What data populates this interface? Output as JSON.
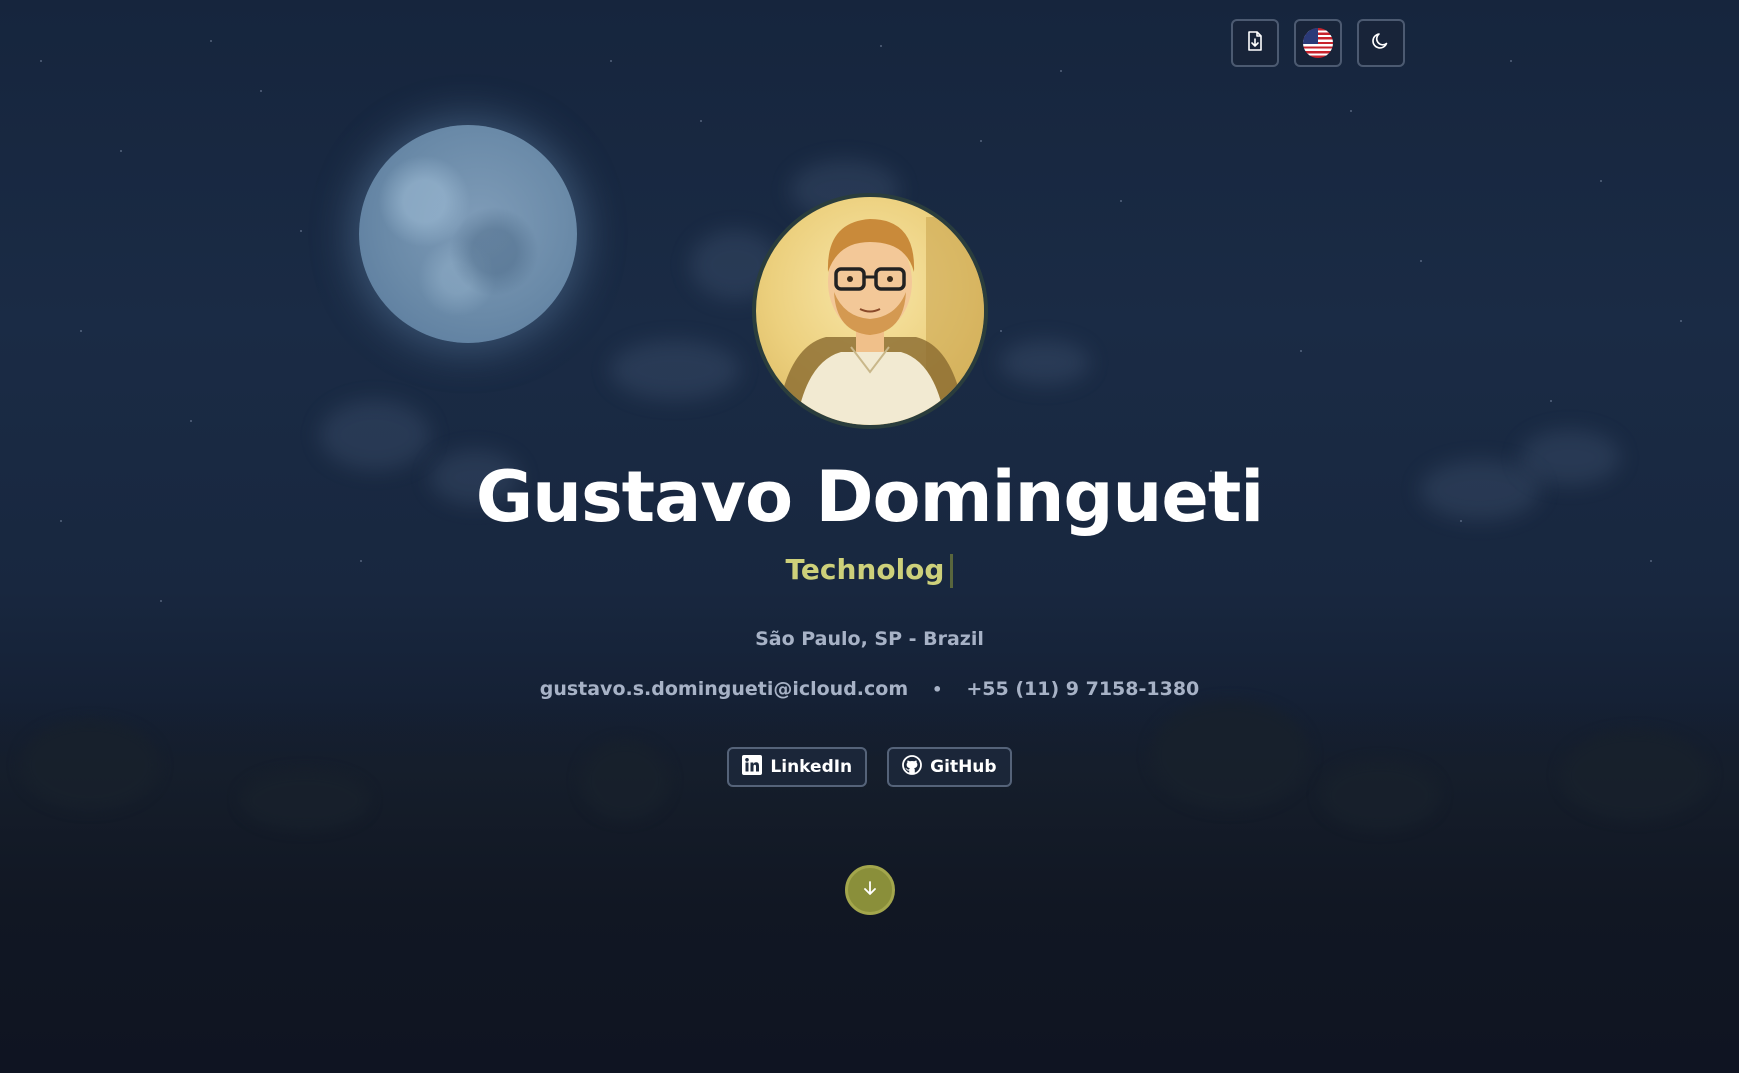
{
  "header": {
    "download_cv_icon": "file-download-icon",
    "language_icon": "us-flag-icon",
    "theme_icon": "moon-icon"
  },
  "profile": {
    "name": "Gustavo Domingueti",
    "role_typing": "Technolog",
    "location": "São Paulo, SP - Brazil",
    "email": "gustavo.s.domingueti@icloud.com",
    "separator": "•",
    "phone": "+55 (11) 9 7158-1380"
  },
  "socials": [
    {
      "label": "LinkedIn",
      "icon": "linkedin-icon"
    },
    {
      "label": "GitHub",
      "icon": "github-icon"
    }
  ],
  "scroll": {
    "icon": "arrow-down-icon"
  },
  "colors": {
    "accent": "#cdd07a",
    "scroll_button": "#8a8f3a",
    "background": "#18273f"
  }
}
